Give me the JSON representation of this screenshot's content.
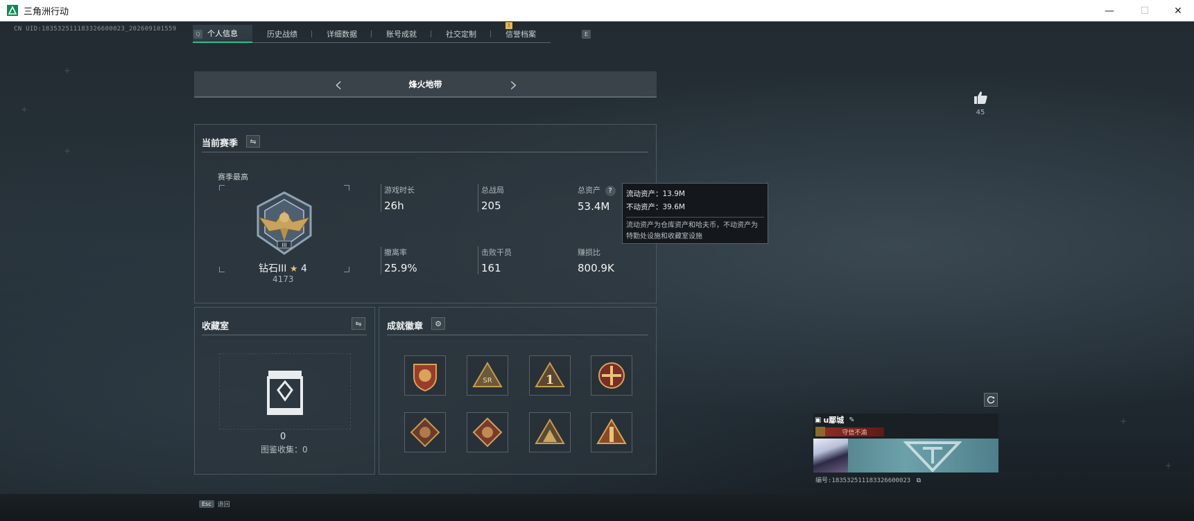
{
  "window": {
    "title": "三角洲行动"
  },
  "uid_line": "CN UID:183532511183326600023_202609101559",
  "tabs": {
    "left_key": "Q",
    "right_key": "E",
    "items": [
      {
        "label": "个人信息",
        "active": true
      },
      {
        "label": "历史战绩"
      },
      {
        "label": "详细数据"
      },
      {
        "label": "账号成就"
      },
      {
        "label": "社交定制"
      },
      {
        "label": "信誉档案"
      }
    ],
    "badge": "!"
  },
  "mode": {
    "label": "烽火地带"
  },
  "season": {
    "title": "当前赛季",
    "highest_label": "赛季最高",
    "rank_name": "钻石III",
    "rank_stars": "4",
    "rank_score": "4173",
    "stats": [
      {
        "label": "游戏时长",
        "value": "26h"
      },
      {
        "label": "总战局",
        "value": "205"
      },
      {
        "label": "总资产",
        "value": "53.4M"
      },
      {
        "label": "撤离率",
        "value": "25.9%"
      },
      {
        "label": "击败干员",
        "value": "161"
      },
      {
        "label": "赚损比",
        "value": "800.9K"
      }
    ]
  },
  "tooltip": {
    "liquid": "流动资产：13.9M",
    "fixed": "不动资产：39.6M",
    "desc": "流动资产为仓库资产和哈夫币，不动资产为特勤处设施和收藏室设施"
  },
  "collection": {
    "title": "收藏室",
    "count": "0",
    "label": "图鉴收集：0"
  },
  "achievements": {
    "title": "成就徽章"
  },
  "likes": {
    "count": "45"
  },
  "esc": {
    "key": "Esc",
    "label": "退回"
  },
  "player_card": {
    "name": "u鄢城",
    "tag": "守信不渝",
    "id_line": "编号:183532511183326600023"
  },
  "colors": {
    "accent_green": "#2fbf86",
    "badge_yellow": "#e0b84b",
    "tag_red": "#8e2a24"
  }
}
